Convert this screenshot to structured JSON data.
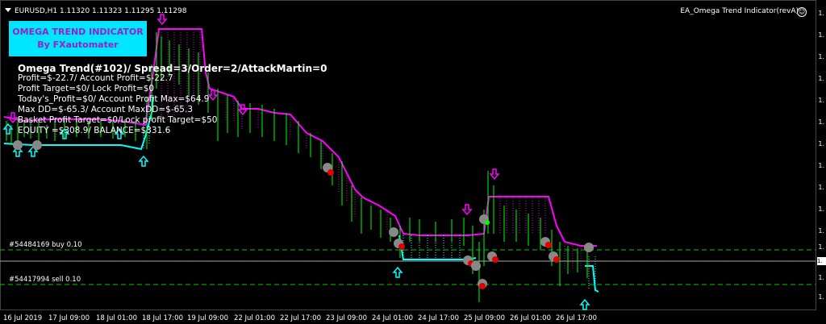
{
  "header": {
    "symbol_info": "EURUSD,H1  1.11320 1.11323 1.11295 1.11298",
    "indicator_name": "EA_Omega Trend Indicator(revA)",
    "smiley": "☺"
  },
  "brand": {
    "line1": "OMEGA TREND INDICATOR",
    "line2": "By FXautomater",
    "bg_color": "#00e6ff",
    "text_color": "#9a1ec8"
  },
  "info": {
    "title": "Omega Trend(#102)/ Spread=3/Order=2/AttackMartin=0",
    "lines": [
      "Profit=$-22.7/ Account Profit=$-22.7",
      "Profit Target=$0/ Lock Profit=$0",
      "Today's_Profit=$0/ Account Profit Max=$64.9",
      "Max DD=$-65.3/ Account MaxDD=$-65.3",
      "Basket Profit Target=$0/Lock profit Target=$50",
      "EQUITY =$308.9/ BALANCE=$331.6"
    ]
  },
  "orders": [
    {
      "label": "#54484169 buy 0.10",
      "color": "#00c800"
    },
    {
      "label": "#54417994 sell 0.10",
      "color": "#00c800"
    }
  ],
  "x_axis": {
    "labels": [
      "16 Jul 2019",
      "17 Jul 09:00",
      "18 Jul 01:00",
      "18 Jul 17:00",
      "19 Jul 09:00",
      "22 Jul 01:00",
      "22 Jul 17:00",
      "23 Jul 09:00",
      "24 Jul 01:00",
      "24 Jul 17:00",
      "25 Jul 09:00",
      "26 Jul 01:00",
      "26 Jul 17:00"
    ]
  },
  "y_axis": {
    "labels": [
      "1.",
      "1.",
      "1.",
      "1.",
      "1.",
      "1.",
      "1.",
      "1.",
      "1.",
      "1.",
      "1.",
      "1.",
      "1.",
      "1."
    ],
    "current_price": "1."
  },
  "colors": {
    "bull_candle": "#00ff00",
    "bear_candle": "#00c800",
    "magenta_band": "#ff00ff",
    "cyan_band": "#00ffff",
    "grid": "#ffffff"
  }
}
